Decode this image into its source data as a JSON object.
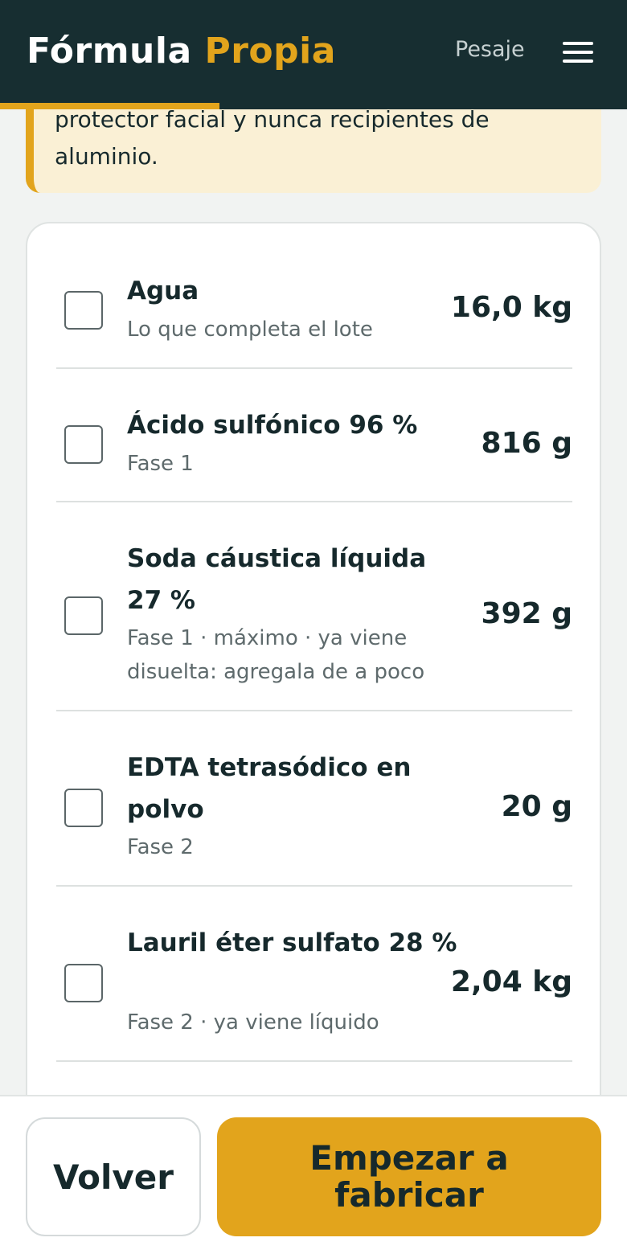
{
  "header": {
    "brand_main": "Fórmula",
    "brand_accent": "Propia",
    "nav_link": "Pesaje",
    "menu_icon": "hamburger-menu-icon",
    "progress_fraction": 0.35
  },
  "warning": {
    "text": "protector facial y nunca recipientes de aluminio."
  },
  "ingredients": [
    {
      "name": "Agua",
      "note": "Lo que completa el lote",
      "quantity": "16,0 kg",
      "checked": false
    },
    {
      "name": "Ácido sulfónico 96 %",
      "note": "Fase 1",
      "quantity": "816 g",
      "checked": false
    },
    {
      "name": "Soda cáustica líquida 27 %",
      "note": "Fase 1 · máximo · ya viene disuelta: agregala de a poco",
      "quantity": "392 g",
      "checked": false
    },
    {
      "name": "EDTA tetrasódico en polvo",
      "note": "Fase 2",
      "quantity": "20 g",
      "checked": false
    },
    {
      "name": "Lauril éter sulfato 28 %",
      "note": "Fase 2 · ya viene líquido",
      "quantity": "2,04 kg",
      "checked": false
    }
  ],
  "footer": {
    "back_label": "Volver",
    "start_label": "Empezar a fabricar"
  },
  "colors": {
    "header_bg": "#172e31",
    "accent": "#e2a41c",
    "warning_bg": "#faf0d5",
    "text_dark": "#16292c",
    "text_muted": "#5e6a6c"
  }
}
